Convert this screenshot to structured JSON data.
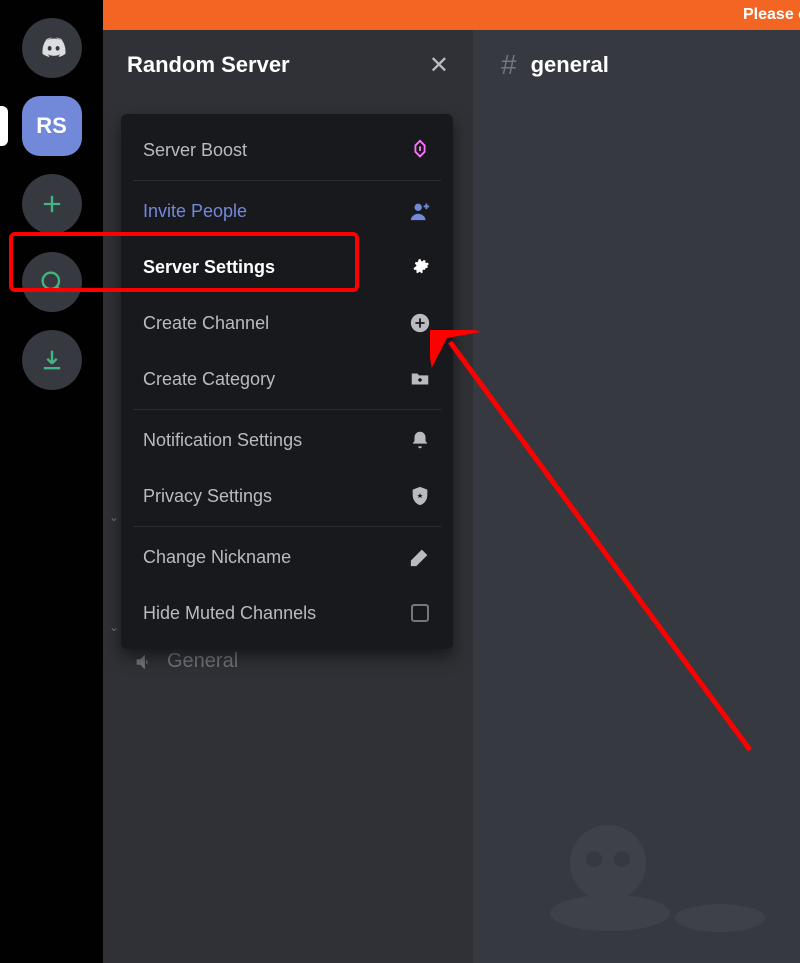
{
  "banner": {
    "text": "Please c"
  },
  "rail": {
    "selected_server_initials": "RS"
  },
  "channel_header": {
    "server_name": "Random Server"
  },
  "popover": {
    "items": [
      {
        "key": "boost",
        "label": "Server Boost",
        "icon": "boost-icon"
      },
      {
        "key": "invite",
        "label": "Invite People",
        "icon": "invite-icon"
      },
      {
        "key": "settings",
        "label": "Server Settings",
        "icon": "gear-icon"
      },
      {
        "key": "createch",
        "label": "Create Channel",
        "icon": "plus-circle-icon"
      },
      {
        "key": "createcat",
        "label": "Create Category",
        "icon": "folder-plus-icon"
      },
      {
        "key": "notif",
        "label": "Notification Settings",
        "icon": "bell-icon"
      },
      {
        "key": "privacy",
        "label": "Privacy Settings",
        "icon": "shield-icon"
      },
      {
        "key": "nick",
        "label": "Change Nickname",
        "icon": "pencil-icon"
      },
      {
        "key": "hide",
        "label": "Hide Muted Channels",
        "icon": "checkbox-icon"
      }
    ]
  },
  "voice_channel": {
    "name": "General"
  },
  "main": {
    "channel_name": "general"
  },
  "colors": {
    "accent": "#7289da",
    "highlight": "#ff0000",
    "banner": "#f26522"
  }
}
